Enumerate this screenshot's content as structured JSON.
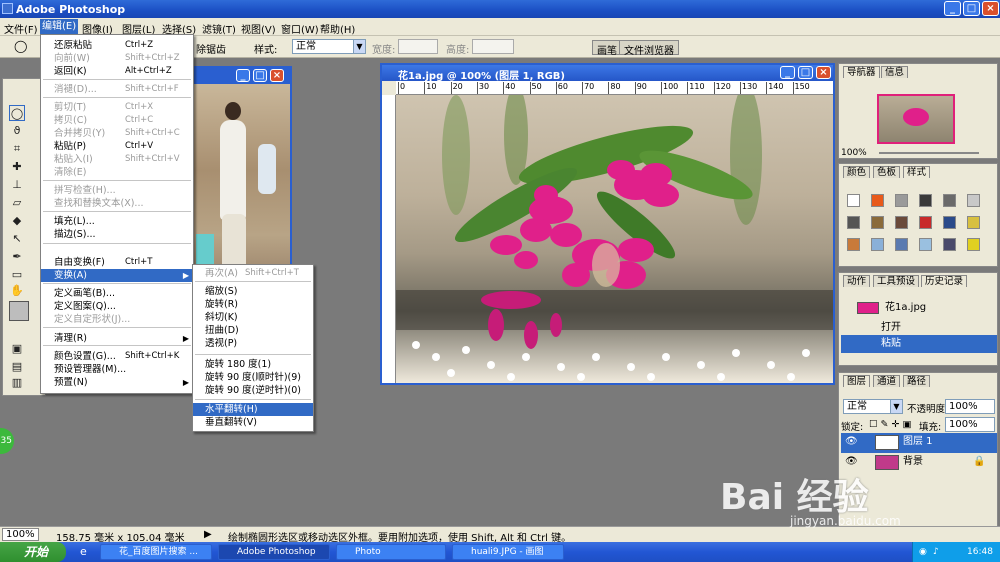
{
  "app": {
    "title": "Adobe Photoshop"
  },
  "menubar": [
    "文件(F)",
    "编辑(E)",
    "图像(I)",
    "图层(L)",
    "选择(S)",
    "滤镜(T)",
    "视图(V)",
    "窗口(W)",
    "帮助(H)"
  ],
  "options": {
    "clear_label": "除锯齿",
    "style_label": "样式:",
    "style_value": "正常",
    "width_label": "宽度:",
    "height_label": "高度:",
    "tab_brush": "画笔",
    "tab_browser": "文件浏览器"
  },
  "edit_menu": [
    {
      "label": "还原粘贴",
      "key": "Ctrl+Z",
      "dis": false
    },
    {
      "label": "向前(W)",
      "key": "Shift+Ctrl+Z",
      "dis": true
    },
    {
      "label": "返回(K)",
      "key": "Alt+Ctrl+Z",
      "dis": false
    },
    {
      "label": "消褪(D)...",
      "key": "Shift+Ctrl+F",
      "dis": true
    },
    {
      "label": "剪切(T)",
      "key": "Ctrl+X",
      "dis": true
    },
    {
      "label": "拷贝(C)",
      "key": "Ctrl+C",
      "dis": true
    },
    {
      "label": "合并拷贝(Y)",
      "key": "Shift+Ctrl+C",
      "dis": true
    },
    {
      "label": "粘贴(P)",
      "key": "Ctrl+V",
      "dis": false
    },
    {
      "label": "粘贴入(I)",
      "key": "Shift+Ctrl+V",
      "dis": true
    },
    {
      "label": "清除(E)",
      "key": "",
      "dis": true
    },
    {
      "label": "拼写检查(H)...",
      "key": "",
      "dis": true
    },
    {
      "label": "查找和替换文本(X)...",
      "key": "",
      "dis": true
    },
    {
      "label": "填充(L)...",
      "key": "",
      "dis": false
    },
    {
      "label": "描边(S)...",
      "key": "",
      "dis": false
    },
    {
      "label": "自由变换(F)",
      "key": "Ctrl+T",
      "dis": false
    },
    {
      "label": "变换(A)",
      "key": "",
      "dis": false
    },
    {
      "label": "定义画笔(B)...",
      "key": "",
      "dis": false
    },
    {
      "label": "定义图案(Q)...",
      "key": "",
      "dis": false
    },
    {
      "label": "定义自定形状(J)...",
      "key": "",
      "dis": true
    },
    {
      "label": "清理(R)",
      "key": "",
      "dis": false
    },
    {
      "label": "颜色设置(G)...",
      "key": "Shift+Ctrl+K",
      "dis": false
    },
    {
      "label": "预设管理器(M)...",
      "key": "",
      "dis": false
    },
    {
      "label": "预置(N)",
      "key": "",
      "dis": false
    }
  ],
  "transform_menu": [
    {
      "label": "再次(A)",
      "key": "Shift+Ctrl+T",
      "dis": true
    },
    {
      "label": "缩放(S)",
      "key": "",
      "dis": false
    },
    {
      "label": "旋转(R)",
      "key": "",
      "dis": false
    },
    {
      "label": "斜切(K)",
      "key": "",
      "dis": false
    },
    {
      "label": "扭曲(D)",
      "key": "",
      "dis": false
    },
    {
      "label": "透视(P)",
      "key": "",
      "dis": false
    },
    {
      "label": "旋转 180 度(1)",
      "key": "",
      "dis": false
    },
    {
      "label": "旋转 90 度(顺时针)(9)",
      "key": "",
      "dis": false
    },
    {
      "label": "旋转 90 度(逆时针)(0)",
      "key": "",
      "dis": false
    },
    {
      "label": "水平翻转(H)",
      "key": "",
      "dis": false
    },
    {
      "label": "垂直翻转(V)",
      "key": "",
      "dis": false
    }
  ],
  "doc": {
    "title": "花1a.jpg @ 100% (图层 1, RGB)",
    "ruler": [
      "0",
      "10",
      "20",
      "30",
      "40",
      "50",
      "60",
      "70",
      "80",
      "90",
      "100",
      "110",
      "120",
      "130",
      "140",
      "150"
    ]
  },
  "navigator": {
    "tabs": [
      "导航器",
      "信息"
    ],
    "zoom": "100%"
  },
  "colors": {
    "tabs": [
      "颜色",
      "色板",
      "样式"
    ]
  },
  "history": {
    "tabs": [
      "动作",
      "工具预设",
      "历史记录"
    ],
    "file": "花1a.jpg",
    "items": [
      "打开",
      "粘贴"
    ]
  },
  "layers": {
    "tabs": [
      "图层",
      "通道",
      "路径"
    ],
    "mode": "正常",
    "opacity_label": "不透明度:",
    "opacity": "100%",
    "lock_label": "锁定:",
    "fill_label": "填充:",
    "fill": "100%",
    "items": [
      "图层 1",
      "背景"
    ]
  },
  "status": {
    "zoom": "100%",
    "size": "158.75 毫米 x 105.04 毫米",
    "hint": "绘制椭圆形选区或移动选区外框。要用附加选项，使用 Shift, Alt 和 Ctrl 键。"
  },
  "taskbar": {
    "start": "开始",
    "items": [
      "花_百度图片搜索 ...",
      "Adobe Photoshop",
      "Photo",
      "huali9.JPG - 画图"
    ],
    "time": "16:48"
  },
  "watermark": {
    "logo": "Bai 经验",
    "url": "jingyan.baidu.com"
  },
  "accent": "#316ac5"
}
